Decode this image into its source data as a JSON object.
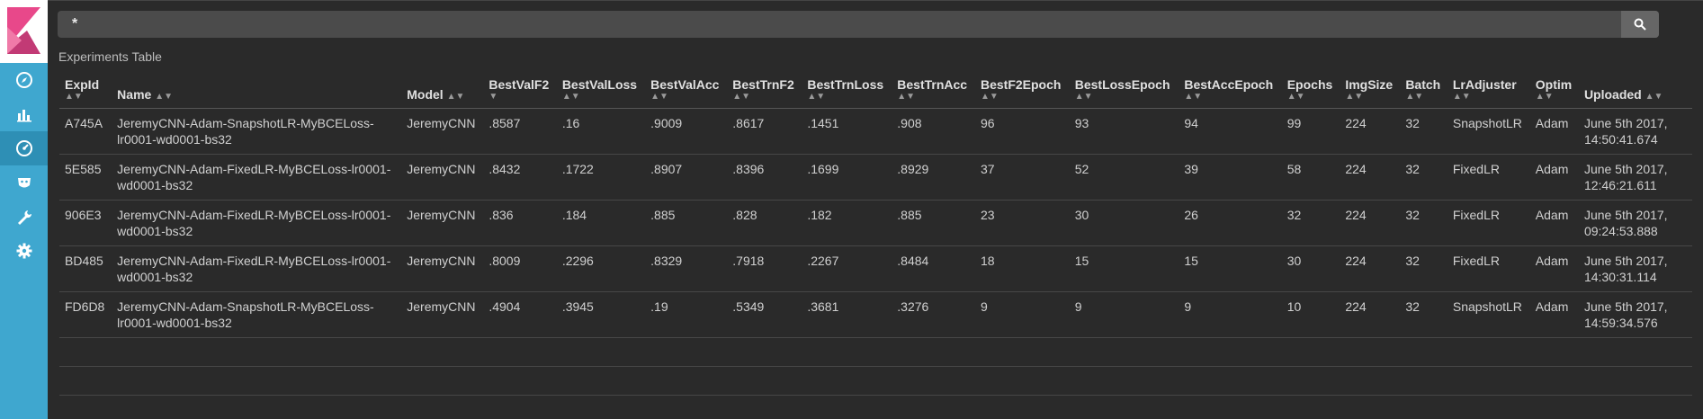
{
  "search": {
    "value": "*"
  },
  "table": {
    "title": "Experiments Table",
    "columns": [
      "ExpId",
      "Name",
      "Model",
      "BestValF2",
      "BestValLoss",
      "BestValAcc",
      "BestTrnF2",
      "BestTrnLoss",
      "BestTrnAcc",
      "BestF2Epoch",
      "BestLossEpoch",
      "BestAccEpoch",
      "Epochs",
      "ImgSize",
      "Batch",
      "LrAdjuster",
      "Optim",
      "Uploaded"
    ],
    "rows": [
      [
        "A745A",
        "JeremyCNN-Adam-SnapshotLR-MyBCELoss-lr0001-wd0001-bs32",
        "JeremyCNN",
        ".8587",
        ".16",
        ".9009",
        ".8617",
        ".1451",
        ".908",
        "96",
        "93",
        "94",
        "99",
        "224",
        "32",
        "SnapshotLR",
        "Adam",
        "June 5th 2017, 14:50:41.674"
      ],
      [
        "5E585",
        "JeremyCNN-Adam-FixedLR-MyBCELoss-lr0001-wd0001-bs32",
        "JeremyCNN",
        ".8432",
        ".1722",
        ".8907",
        ".8396",
        ".1699",
        ".8929",
        "37",
        "52",
        "39",
        "58",
        "224",
        "32",
        "FixedLR",
        "Adam",
        "June 5th 2017, 12:46:21.611"
      ],
      [
        "906E3",
        "JeremyCNN-Adam-FixedLR-MyBCELoss-lr0001-wd0001-bs32",
        "JeremyCNN",
        ".836",
        ".184",
        ".885",
        ".828",
        ".182",
        ".885",
        "23",
        "30",
        "26",
        "32",
        "224",
        "32",
        "FixedLR",
        "Adam",
        "June 5th 2017, 09:24:53.888"
      ],
      [
        "BD485",
        "JeremyCNN-Adam-FixedLR-MyBCELoss-lr0001-wd0001-bs32",
        "JeremyCNN",
        ".8009",
        ".2296",
        ".8329",
        ".7918",
        ".2267",
        ".8484",
        "18",
        "15",
        "15",
        "30",
        "224",
        "32",
        "FixedLR",
        "Adam",
        "June 5th 2017, 14:30:31.114"
      ],
      [
        "FD6D8",
        "JeremyCNN-Adam-SnapshotLR-MyBCELoss-lr0001-wd0001-bs32",
        "JeremyCNN",
        ".4904",
        ".3945",
        ".19",
        ".5349",
        ".3681",
        ".3276",
        "9",
        "9",
        "9",
        "10",
        "224",
        "32",
        "SnapshotLR",
        "Adam",
        "June 5th 2017, 14:59:34.576"
      ]
    ]
  },
  "sidebar": {
    "icons": [
      "discover-icon",
      "visualize-icon",
      "dashboard-icon",
      "timelion-icon",
      "devtools-icon",
      "settings-icon"
    ]
  },
  "colors": {
    "sidebar": "#3fa7cf",
    "logo_pink": "#e8488a",
    "background": "#2a2a2a"
  }
}
